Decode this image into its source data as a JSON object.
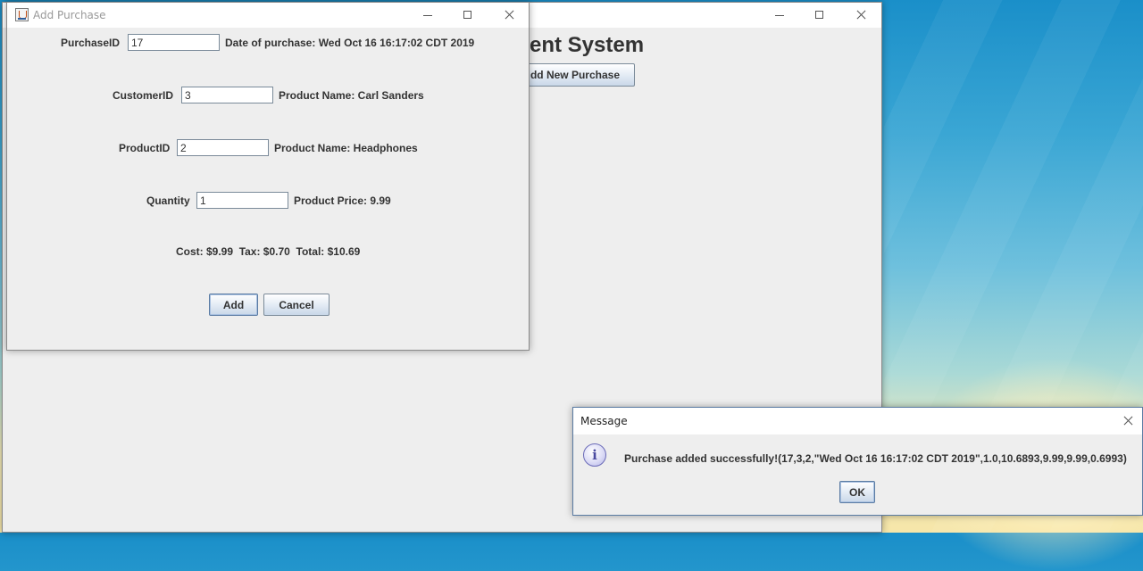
{
  "main_window": {
    "heading": "ent System",
    "add_new_purchase_button": "dd New Purchase"
  },
  "add_purchase_dialog": {
    "title": "Add Purchase",
    "purchase_id": {
      "label": "PurchaseID",
      "value": "17"
    },
    "date_of_purchase": "Date of purchase: Wed Oct 16 16:17:02 CDT 2019",
    "customer_id": {
      "label": "CustomerID",
      "value": "3"
    },
    "customer_name": "Product Name: Carl Sanders",
    "product_id": {
      "label": "ProductID",
      "value": "2"
    },
    "product_name": "Product Name: Headphones",
    "quantity": {
      "label": "Quantity",
      "value": "1"
    },
    "product_price": "Product Price: 9.99",
    "totals": "Cost: $9.99  Tax: $0.70  Total: $10.69",
    "add_button": "Add",
    "cancel_button": "Cancel"
  },
  "message_dialog": {
    "title": "Message",
    "icon": "info-icon",
    "text": "Purchase added successfully!(17,3,2,\"Wed Oct 16 16:17:02 CDT 2019\",1.0,10.6893,9.99,9.99,0.6993)",
    "ok_button": "OK"
  }
}
